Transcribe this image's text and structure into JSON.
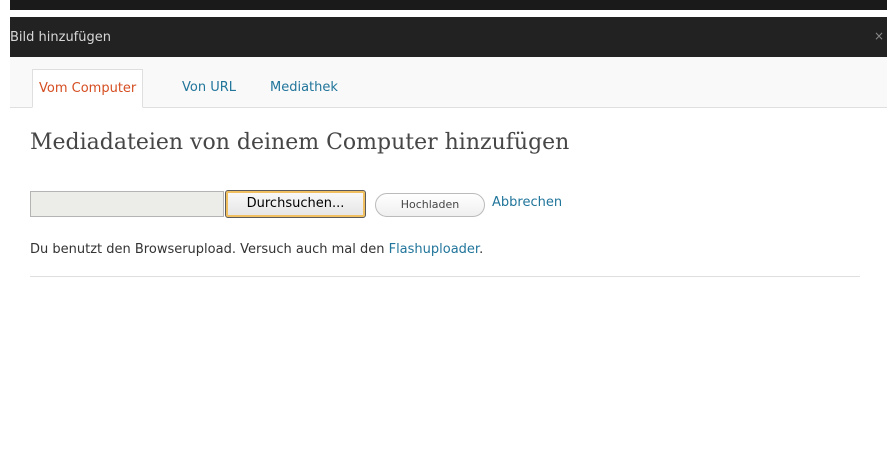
{
  "dialog": {
    "title": "Bild hinzufügen",
    "close_glyph": "×"
  },
  "tabs": [
    {
      "label": "Vom Computer",
      "active": true
    },
    {
      "label": "Von URL",
      "active": false
    },
    {
      "label": "Mediathek",
      "active": false
    }
  ],
  "main": {
    "heading": "Mediadateien von deinem Computer hinzufügen",
    "file_input_value": "",
    "browse_label": "Durchsuchen...",
    "upload_label": "Hochladen",
    "cancel_label": "Abbrechen",
    "info_text": "Du benutzt den Browserupload. Versuch auch mal den ",
    "info_link": "Flashuploader",
    "info_suffix": "."
  },
  "icons": {
    "close": "close-icon"
  },
  "colors": {
    "titlebar": "#222222",
    "link": "#21759b",
    "active_tab": "#d54e21"
  }
}
